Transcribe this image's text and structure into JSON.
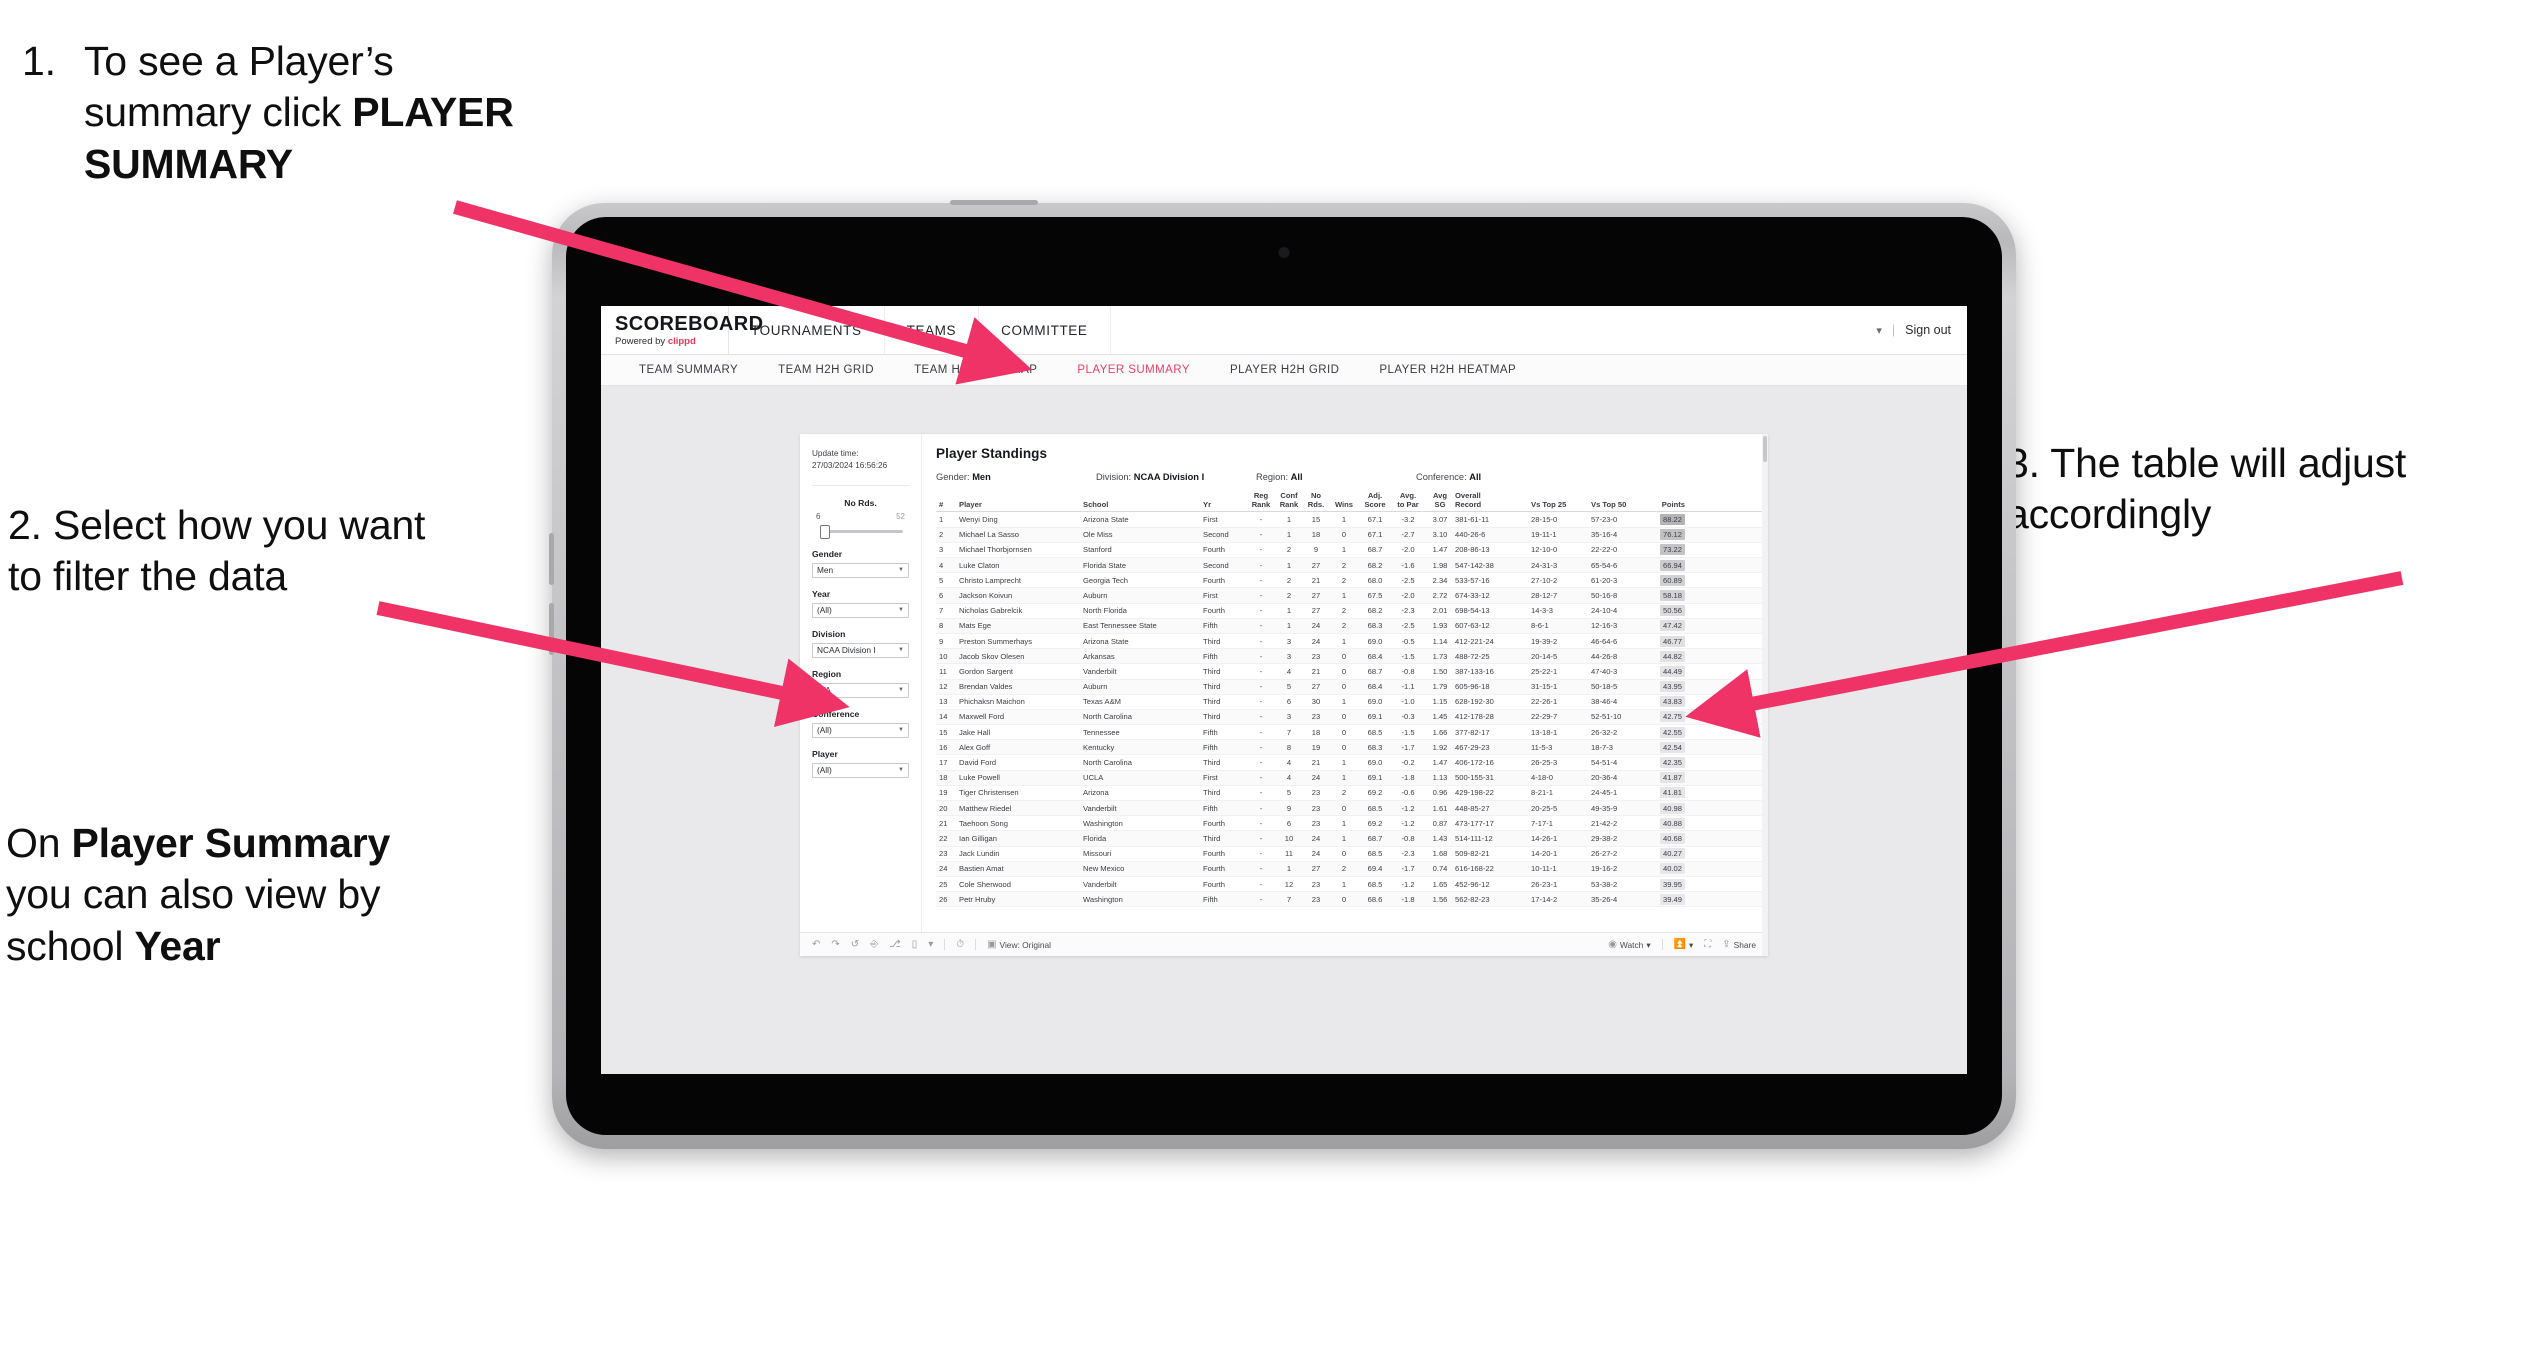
{
  "annotations": {
    "step1_number": "1.",
    "step1_text_a": "To see a Player’s",
    "step1_text_b": "summary click ",
    "step1_bold": "PLAYER SUMMARY",
    "step2": "2. Select how you want to filter the data",
    "step3_pre": "On ",
    "step3_bold1": "Player Summary",
    "step3_mid": " you can also view by school ",
    "step3_bold2": "Year",
    "step4": "3. The table will adjust accordingly",
    "arrow_color": "#ef3366"
  },
  "app": {
    "logo_main": "SCOREBOARD",
    "logo_sub_pre": "Powered by ",
    "logo_sub_brand": "clippd",
    "header_nav": [
      "TOURNAMENTS",
      "TEAMS",
      "COMMITTEE"
    ],
    "sign_out": "Sign out",
    "subnav": [
      {
        "label": "TEAM SUMMARY",
        "active": false
      },
      {
        "label": "TEAM H2H GRID",
        "active": false
      },
      {
        "label": "TEAM H2H HEATMAP",
        "active": false
      },
      {
        "label": "PLAYER SUMMARY",
        "active": true
      },
      {
        "label": "PLAYER H2H GRID",
        "active": false
      },
      {
        "label": "PLAYER H2H HEATMAP",
        "active": false
      }
    ],
    "accent": "#ef3e66"
  },
  "filters": {
    "update_label": "Update time:",
    "update_value": "27/03/2024 16:56:26",
    "no_rds_label": "No Rds.",
    "no_rds_min": "6",
    "no_rds_max": "52",
    "groups": [
      {
        "label": "Gender",
        "value": "Men"
      },
      {
        "label": "Year",
        "value": "(All)"
      },
      {
        "label": "Division",
        "value": "NCAA Division I"
      },
      {
        "label": "Region",
        "value": "N/A"
      },
      {
        "label": "Conference",
        "value": "(All)"
      },
      {
        "label": "Player",
        "value": "(All)"
      }
    ]
  },
  "viz": {
    "title": "Player Standings",
    "meta": [
      {
        "label": "Gender:",
        "value": "Men"
      },
      {
        "label": "Division:",
        "value": "NCAA Division I"
      },
      {
        "label": "Region:",
        "value": "All"
      },
      {
        "label": "Conference:",
        "value": "All"
      }
    ],
    "columns": [
      {
        "l1": "#",
        "l2": ""
      },
      {
        "l1": "Player",
        "l2": ""
      },
      {
        "l1": "School",
        "l2": ""
      },
      {
        "l1": "Yr",
        "l2": ""
      },
      {
        "l1": "Reg",
        "l2": "Rank"
      },
      {
        "l1": "Conf",
        "l2": "Rank"
      },
      {
        "l1": "No",
        "l2": "Rds."
      },
      {
        "l1": "Wins",
        "l2": ""
      },
      {
        "l1": "Adj.",
        "l2": "Score"
      },
      {
        "l1": "Avg.",
        "l2": "to Par"
      },
      {
        "l1": "Avg",
        "l2": "SG"
      },
      {
        "l1": "Overall",
        "l2": "Record"
      },
      {
        "l1": "Vs Top 25",
        "l2": ""
      },
      {
        "l1": "Vs Top 50",
        "l2": ""
      },
      {
        "l1": "Points",
        "l2": ""
      }
    ],
    "rows": [
      {
        "n": "1",
        "player": "Wenyi Ding",
        "school": "Arizona State",
        "yr": "First",
        "reg": "-",
        "conf": "1",
        "nords": "15",
        "wins": "1",
        "adj": "67.1",
        "par": "-3.2",
        "sg": "3.07",
        "rec": "381-61-11",
        "t25": "28-15-0",
        "t50": "57-23-0",
        "pts": "88.22"
      },
      {
        "n": "2",
        "player": "Michael La Sasso",
        "school": "Ole Miss",
        "yr": "Second",
        "reg": "-",
        "conf": "1",
        "nords": "18",
        "wins": "0",
        "adj": "67.1",
        "par": "-2.7",
        "sg": "3.10",
        "rec": "440-26-6",
        "t25": "19-11-1",
        "t50": "35-16-4",
        "pts": "76.12"
      },
      {
        "n": "3",
        "player": "Michael Thorbjornsen",
        "school": "Stanford",
        "yr": "Fourth",
        "reg": "-",
        "conf": "2",
        "nords": "9",
        "wins": "1",
        "adj": "68.7",
        "par": "-2.0",
        "sg": "1.47",
        "rec": "208-86-13",
        "t25": "12-10-0",
        "t50": "22-22-0",
        "pts": "73.22"
      },
      {
        "n": "4",
        "player": "Luke Claton",
        "school": "Florida State",
        "yr": "Second",
        "reg": "-",
        "conf": "1",
        "nords": "27",
        "wins": "2",
        "adj": "68.2",
        "par": "-1.6",
        "sg": "1.98",
        "rec": "547-142-38",
        "t25": "24-31-3",
        "t50": "65-54-6",
        "pts": "66.94"
      },
      {
        "n": "5",
        "player": "Christo Lamprecht",
        "school": "Georgia Tech",
        "yr": "Fourth",
        "reg": "-",
        "conf": "2",
        "nords": "21",
        "wins": "2",
        "adj": "68.0",
        "par": "-2.5",
        "sg": "2.34",
        "rec": "533-57-16",
        "t25": "27-10-2",
        "t50": "61-20-3",
        "pts": "60.89"
      },
      {
        "n": "6",
        "player": "Jackson Koivun",
        "school": "Auburn",
        "yr": "First",
        "reg": "-",
        "conf": "2",
        "nords": "27",
        "wins": "1",
        "adj": "67.5",
        "par": "-2.0",
        "sg": "2.72",
        "rec": "674-33-12",
        "t25": "28-12-7",
        "t50": "50-16-8",
        "pts": "58.18"
      },
      {
        "n": "7",
        "player": "Nicholas Gabrelcik",
        "school": "North Florida",
        "yr": "Fourth",
        "reg": "-",
        "conf": "1",
        "nords": "27",
        "wins": "2",
        "adj": "68.2",
        "par": "-2.3",
        "sg": "2.01",
        "rec": "698-54-13",
        "t25": "14-3-3",
        "t50": "24-10-4",
        "pts": "50.56"
      },
      {
        "n": "8",
        "player": "Mats Ege",
        "school": "East Tennessee State",
        "yr": "Fifth",
        "reg": "-",
        "conf": "1",
        "nords": "24",
        "wins": "2",
        "adj": "68.3",
        "par": "-2.5",
        "sg": "1.93",
        "rec": "607-63-12",
        "t25": "8-6-1",
        "t50": "12-16-3",
        "pts": "47.42"
      },
      {
        "n": "9",
        "player": "Preston Summerhays",
        "school": "Arizona State",
        "yr": "Third",
        "reg": "-",
        "conf": "3",
        "nords": "24",
        "wins": "1",
        "adj": "69.0",
        "par": "-0.5",
        "sg": "1.14",
        "rec": "412-221-24",
        "t25": "19-39-2",
        "t50": "46-64-6",
        "pts": "46.77"
      },
      {
        "n": "10",
        "player": "Jacob Skov Olesen",
        "school": "Arkansas",
        "yr": "Fifth",
        "reg": "-",
        "conf": "3",
        "nords": "23",
        "wins": "0",
        "adj": "68.4",
        "par": "-1.5",
        "sg": "1.73",
        "rec": "488-72-25",
        "t25": "20-14-5",
        "t50": "44-26-8",
        "pts": "44.82"
      },
      {
        "n": "11",
        "player": "Gordon Sargent",
        "school": "Vanderbilt",
        "yr": "Third",
        "reg": "-",
        "conf": "4",
        "nords": "21",
        "wins": "0",
        "adj": "68.7",
        "par": "-0.8",
        "sg": "1.50",
        "rec": "387-133-16",
        "t25": "25-22-1",
        "t50": "47-40-3",
        "pts": "44.49"
      },
      {
        "n": "12",
        "player": "Brendan Valdes",
        "school": "Auburn",
        "yr": "Third",
        "reg": "-",
        "conf": "5",
        "nords": "27",
        "wins": "0",
        "adj": "68.4",
        "par": "-1.1",
        "sg": "1.79",
        "rec": "605-96-18",
        "t25": "31-15-1",
        "t50": "50-18-5",
        "pts": "43.95"
      },
      {
        "n": "13",
        "player": "Phichaksn Maichon",
        "school": "Texas A&M",
        "yr": "Third",
        "reg": "-",
        "conf": "6",
        "nords": "30",
        "wins": "1",
        "adj": "69.0",
        "par": "-1.0",
        "sg": "1.15",
        "rec": "628-192-30",
        "t25": "22-26-1",
        "t50": "38-46-4",
        "pts": "43.83"
      },
      {
        "n": "14",
        "player": "Maxwell Ford",
        "school": "North Carolina",
        "yr": "Third",
        "reg": "-",
        "conf": "3",
        "nords": "23",
        "wins": "0",
        "adj": "69.1",
        "par": "-0.3",
        "sg": "1.45",
        "rec": "412-178-28",
        "t25": "22-29-7",
        "t50": "52-51-10",
        "pts": "42.75"
      },
      {
        "n": "15",
        "player": "Jake Hall",
        "school": "Tennessee",
        "yr": "Fifth",
        "reg": "-",
        "conf": "7",
        "nords": "18",
        "wins": "0",
        "adj": "68.5",
        "par": "-1.5",
        "sg": "1.66",
        "rec": "377-82-17",
        "t25": "13-18-1",
        "t50": "26-32-2",
        "pts": "42.55"
      },
      {
        "n": "16",
        "player": "Alex Goff",
        "school": "Kentucky",
        "yr": "Fifth",
        "reg": "-",
        "conf": "8",
        "nords": "19",
        "wins": "0",
        "adj": "68.3",
        "par": "-1.7",
        "sg": "1.92",
        "rec": "467-29-23",
        "t25": "11-5-3",
        "t50": "18-7-3",
        "pts": "42.54"
      },
      {
        "n": "17",
        "player": "David Ford",
        "school": "North Carolina",
        "yr": "Third",
        "reg": "-",
        "conf": "4",
        "nords": "21",
        "wins": "1",
        "adj": "69.0",
        "par": "-0.2",
        "sg": "1.47",
        "rec": "406-172-16",
        "t25": "26-25-3",
        "t50": "54-51-4",
        "pts": "42.35"
      },
      {
        "n": "18",
        "player": "Luke Powell",
        "school": "UCLA",
        "yr": "First",
        "reg": "-",
        "conf": "4",
        "nords": "24",
        "wins": "1",
        "adj": "69.1",
        "par": "-1.8",
        "sg": "1.13",
        "rec": "500-155-31",
        "t25": "4-18-0",
        "t50": "20-36-4",
        "pts": "41.87"
      },
      {
        "n": "19",
        "player": "Tiger Christensen",
        "school": "Arizona",
        "yr": "Third",
        "reg": "-",
        "conf": "5",
        "nords": "23",
        "wins": "2",
        "adj": "69.2",
        "par": "-0.6",
        "sg": "0.96",
        "rec": "429-198-22",
        "t25": "8-21-1",
        "t50": "24-45-1",
        "pts": "41.81"
      },
      {
        "n": "20",
        "player": "Matthew Riedel",
        "school": "Vanderbilt",
        "yr": "Fifth",
        "reg": "-",
        "conf": "9",
        "nords": "23",
        "wins": "0",
        "adj": "68.5",
        "par": "-1.2",
        "sg": "1.61",
        "rec": "448-85-27",
        "t25": "20-25-5",
        "t50": "49-35-9",
        "pts": "40.98"
      },
      {
        "n": "21",
        "player": "Taehoon Song",
        "school": "Washington",
        "yr": "Fourth",
        "reg": "-",
        "conf": "6",
        "nords": "23",
        "wins": "1",
        "adj": "69.2",
        "par": "-1.2",
        "sg": "0.87",
        "rec": "473-177-17",
        "t25": "7-17-1",
        "t50": "21-42-2",
        "pts": "40.88"
      },
      {
        "n": "22",
        "player": "Ian Gilligan",
        "school": "Florida",
        "yr": "Third",
        "reg": "-",
        "conf": "10",
        "nords": "24",
        "wins": "1",
        "adj": "68.7",
        "par": "-0.8",
        "sg": "1.43",
        "rec": "514-111-12",
        "t25": "14-26-1",
        "t50": "29-38-2",
        "pts": "40.68"
      },
      {
        "n": "23",
        "player": "Jack Lundin",
        "school": "Missouri",
        "yr": "Fourth",
        "reg": "-",
        "conf": "11",
        "nords": "24",
        "wins": "0",
        "adj": "68.5",
        "par": "-2.3",
        "sg": "1.68",
        "rec": "509-82-21",
        "t25": "14-20-1",
        "t50": "26-27-2",
        "pts": "40.27"
      },
      {
        "n": "24",
        "player": "Bastien Amat",
        "school": "New Mexico",
        "yr": "Fourth",
        "reg": "-",
        "conf": "1",
        "nords": "27",
        "wins": "2",
        "adj": "69.4",
        "par": "-1.7",
        "sg": "0.74",
        "rec": "616-168-22",
        "t25": "10-11-1",
        "t50": "19-16-2",
        "pts": "40.02"
      },
      {
        "n": "25",
        "player": "Cole Sherwood",
        "school": "Vanderbilt",
        "yr": "Fourth",
        "reg": "-",
        "conf": "12",
        "nords": "23",
        "wins": "1",
        "adj": "68.5",
        "par": "-1.2",
        "sg": "1.65",
        "rec": "452-96-12",
        "t25": "26-23-1",
        "t50": "53-38-2",
        "pts": "39.95"
      },
      {
        "n": "26",
        "player": "Petr Hruby",
        "school": "Washington",
        "yr": "Fifth",
        "reg": "-",
        "conf": "7",
        "nords": "23",
        "wins": "0",
        "adj": "68.6",
        "par": "-1.8",
        "sg": "1.56",
        "rec": "562-82-23",
        "t25": "17-14-2",
        "t50": "35-26-4",
        "pts": "39.49"
      }
    ]
  },
  "toolbar": {
    "view_label": "View: Original",
    "watch_label": "Watch",
    "share_label": "Share"
  }
}
